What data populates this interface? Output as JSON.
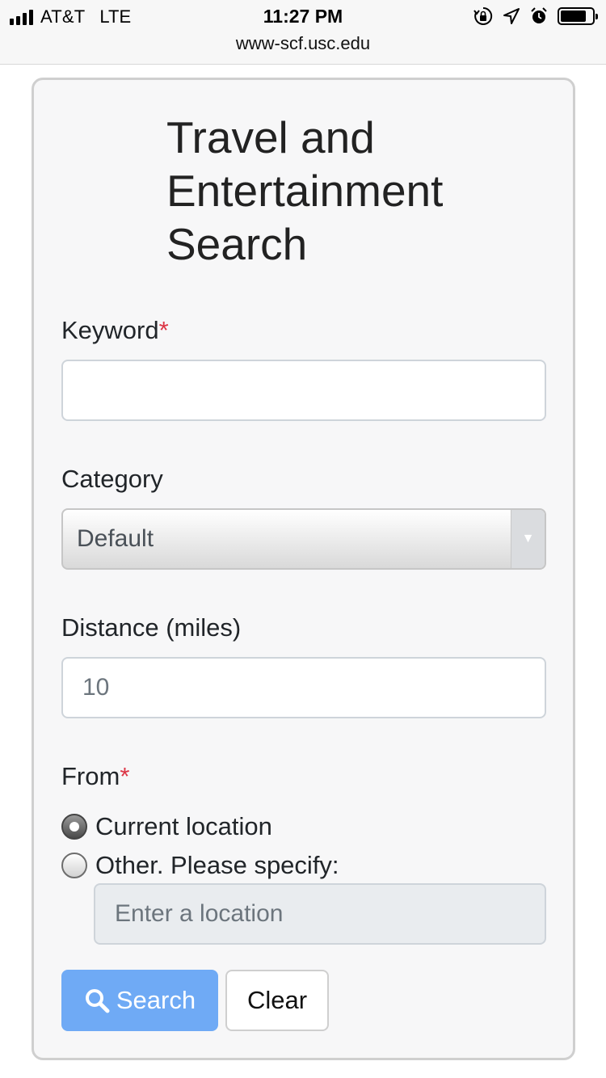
{
  "status_bar": {
    "carrier": "AT&T",
    "network": "LTE",
    "time": "11:27 PM",
    "url": "www-scf.usc.edu",
    "icons": [
      "signal-icon",
      "rotation-lock-icon",
      "location-arrow-icon",
      "alarm-icon",
      "battery-icon"
    ]
  },
  "form": {
    "title": "Travel and Entertainment Search",
    "keyword": {
      "label": "Keyword",
      "required_mark": "*",
      "value": ""
    },
    "category": {
      "label": "Category",
      "selected": "Default"
    },
    "distance": {
      "label": "Distance (miles)",
      "placeholder": "10"
    },
    "from": {
      "label": "From",
      "required_mark": "*",
      "option_current": "Current location",
      "option_other": "Other. Please specify:",
      "location_placeholder": "Enter a location",
      "selected": "current"
    },
    "search_button": "Search",
    "clear_button": "Clear"
  },
  "colors": {
    "required": "#dc3545",
    "search_button": "#6faaf5",
    "card_background": "#f7f7f8"
  }
}
